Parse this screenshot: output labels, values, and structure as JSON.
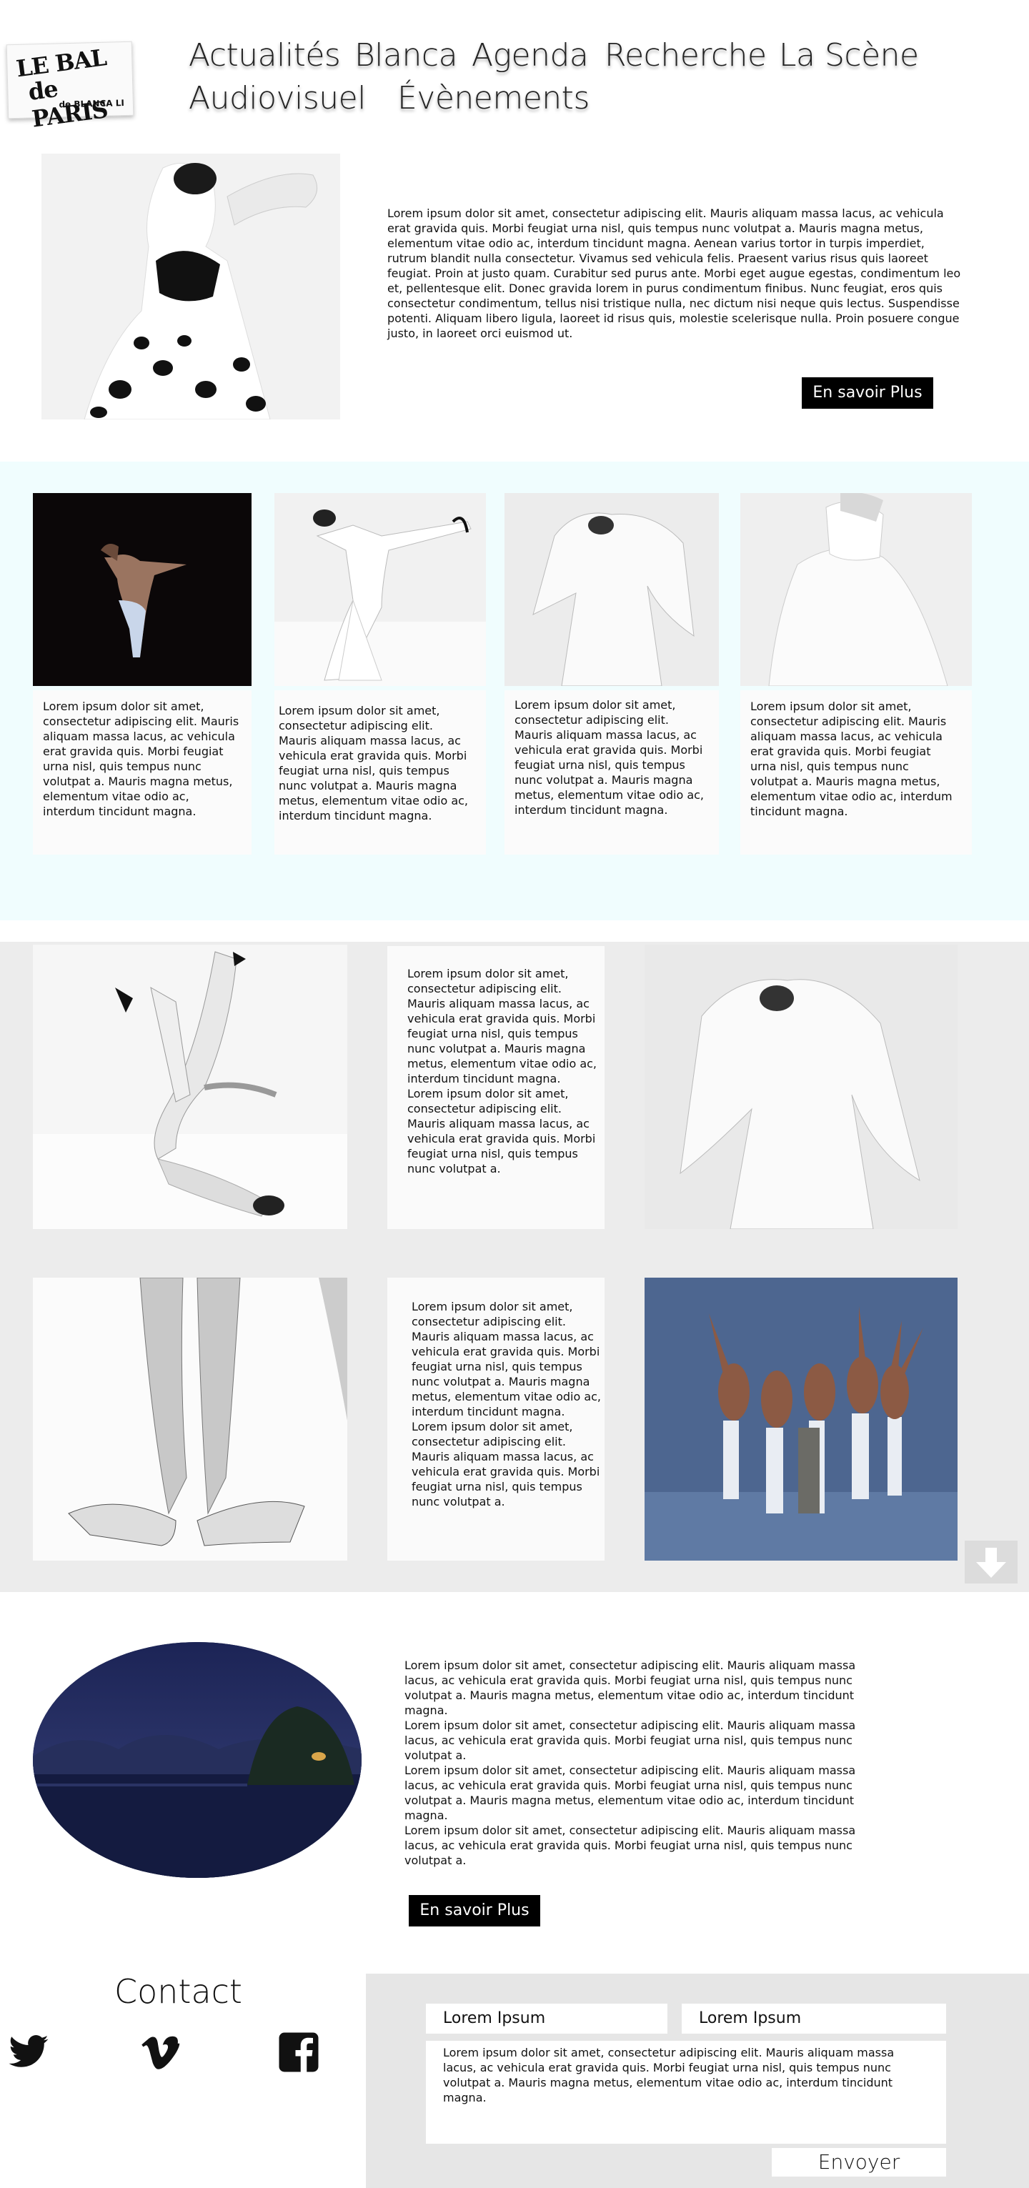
{
  "logo": {
    "line1": "LE BAL",
    "line2": "de PARIS",
    "line3": "de BLANCA LI"
  },
  "nav": {
    "items": [
      {
        "label": "Actualités"
      },
      {
        "label": "Blanca"
      },
      {
        "label": "Agenda"
      },
      {
        "label": "Recherche"
      },
      {
        "label": "La Scène"
      },
      {
        "label": "Audiovisuel"
      },
      {
        "label": "Évènements"
      }
    ]
  },
  "intro": {
    "text": "Lorem ipsum dolor sit amet, consectetur adipiscing elit. Mauris aliquam massa lacus, ac vehicula erat gravida quis. Morbi feugiat urna nisl, quis tempus nunc volutpat a. Mauris magna metus, elementum vitae odio ac, interdum tincidunt magna. Aenean varius tortor in turpis imperdiet, rutrum blandit nulla consectetur. Vivamus sed vehicula felis. Praesent varius risus quis laoreet feugiat. Proin at justo quam. Curabitur sed purus ante. Morbi eget augue egestas, condimentum leo et, pellentesque elit. Donec gravida lorem in purus condimentum finibus. Nunc feugiat, eros quis consectetur condimentum, tellus nisi tristique nulla, nec dictum nisi neque quis lectus. Suspendisse potenti. Aliquam libero ligula, laoreet id risus quis, molestie scelerisque nulla. Proin posuere congue justo, in laoreet orci euismod ut.",
    "button": "En savoir Plus"
  },
  "cards": [
    {
      "text": "Lorem ipsum dolor sit amet, consectetur adipiscing elit. Mauris aliquam massa lacus, ac vehicula erat gravida quis. Morbi feugiat urna nisl, quis tempus nunc volutpat a. Mauris magna metus, elementum vitae odio ac, interdum tincidunt magna."
    },
    {
      "text": "Lorem ipsum dolor sit amet, consectetur adipiscing elit. Mauris aliquam massa lacus, ac vehicula erat gravida quis. Morbi feugiat urna nisl, quis tempus nunc volutpat a. Mauris magna metus, elementum vitae odio ac, interdum tincidunt magna."
    },
    {
      "text": "Lorem ipsum dolor sit amet, consectetur adipiscing elit. Mauris aliquam massa lacus, ac vehicula erat gravida quis. Morbi feugiat urna nisl, quis tempus nunc volutpat a. Mauris magna metus, elementum vitae odio ac, interdum tincidunt magna."
    },
    {
      "text": "Lorem ipsum dolor sit amet, consectetur adipiscing elit. Mauris aliquam massa lacus, ac vehicula erat gravida quis. Morbi feugiat urna nisl, quis tempus nunc volutpat a. Mauris magna metus, elementum vitae odio ac, interdum tincidunt magna."
    }
  ],
  "gallery": [
    {
      "text": "Lorem ipsum dolor sit amet, consectetur adipiscing elit. Mauris aliquam massa lacus, ac vehicula erat gravida quis. Morbi feugiat urna nisl, quis tempus nunc volutpat a. Mauris magna metus, elementum vitae odio ac, interdum tincidunt magna. Lorem ipsum dolor sit amet, consectetur adipiscing elit. Mauris aliquam massa lacus, ac vehicula erat gravida quis. Morbi feugiat urna nisl, quis tempus nunc volutpat a."
    },
    {
      "text": "Lorem ipsum dolor sit amet, consectetur adipiscing elit. Mauris aliquam massa lacus, ac vehicula erat gravida quis. Morbi feugiat urna nisl, quis tempus nunc volutpat a. Mauris magna metus, elementum vitae odio ac, interdum tincidunt magna. Lorem ipsum dolor sit amet, consectetur adipiscing elit. Mauris aliquam massa lacus, ac vehicula erat gravida quis. Morbi feugiat urna nisl, quis tempus nunc volutpat a."
    }
  ],
  "scroll_icon": "arrow-down-icon",
  "feature": {
    "paragraphs": [
      "Lorem ipsum dolor sit amet, consectetur adipiscing elit. Mauris aliquam massa lacus, ac vehicula erat gravida quis. Morbi feugiat urna nisl, quis tempus nunc volutpat a. Mauris magna metus, elementum vitae odio ac, interdum tincidunt magna.",
      "Lorem ipsum dolor sit amet, consectetur adipiscing elit. Mauris aliquam massa lacus, ac vehicula erat gravida quis. Morbi feugiat urna nisl, quis tempus nunc volutpat a.",
      "Lorem ipsum dolor sit amet, consectetur adipiscing elit. Mauris aliquam massa lacus, ac vehicula erat gravida quis. Morbi feugiat urna nisl, quis tempus nunc volutpat a. Mauris magna metus, elementum vitae odio ac, interdum tincidunt magna.",
      "Lorem ipsum dolor sit amet, consectetur adipiscing elit. Mauris aliquam massa lacus, ac vehicula erat gravida quis. Morbi feugiat urna nisl, quis tempus nunc volutpat a."
    ],
    "button": "En savoir Plus"
  },
  "contact": {
    "title": "Contact",
    "social": [
      {
        "name": "twitter-icon"
      },
      {
        "name": "vimeo-icon"
      },
      {
        "name": "facebook-icon"
      }
    ],
    "form": {
      "field1": "Lorem Ipsum",
      "field2": "Lorem Ipsum",
      "message": "Lorem ipsum dolor sit amet, consectetur adipiscing elit. Mauris aliquam massa lacus, ac vehicula erat gravida quis. Morbi feugiat urna nisl, quis tempus nunc volutpat a. Mauris magna metus, elementum vitae odio ac, interdum tincidunt magna.",
      "submit": "Envoyer"
    }
  }
}
